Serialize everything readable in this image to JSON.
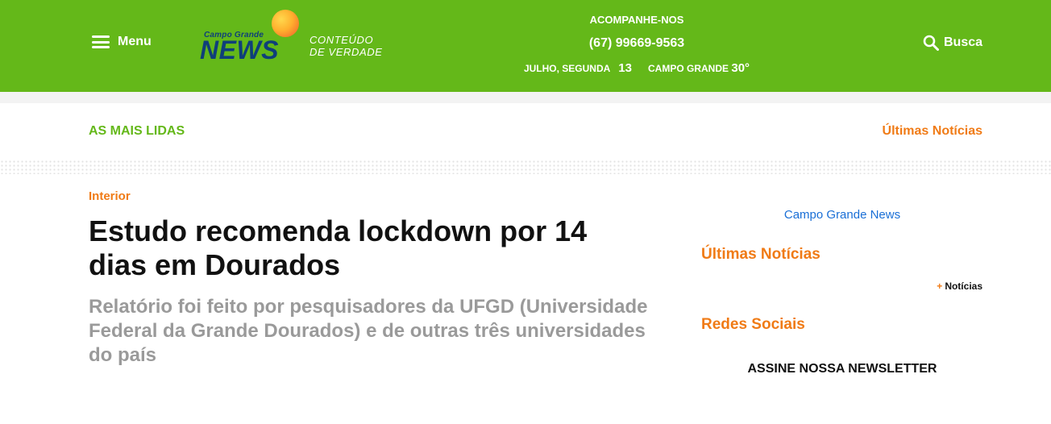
{
  "header": {
    "menu_label": "Menu",
    "logo": {
      "small": "Campo Grande",
      "big": "NEWS"
    },
    "tagline_line1": "CONTEÚDO",
    "tagline_line2": "DE VERDADE",
    "follow_label": "ACOMPANHE-NOS",
    "phone": "(67) 99669-9563",
    "date_label": "JULHO, SEGUNDA",
    "date_day": "13",
    "city": "CAMPO GRANDE",
    "temperature": "30°",
    "search_label": "Busca"
  },
  "subnav": {
    "most_read": "AS MAIS LIDAS",
    "latest": "Últimas Notícias"
  },
  "article": {
    "category": "Interior",
    "headline": "Estudo recomenda lockdown por 14 dias em Dourados",
    "subheadline": "Relatório foi feito por pesquisadores da UFGD (Universidade Federal da Grande Dourados) e de outras três universidades do país"
  },
  "sidebar": {
    "site_link": "Campo Grande News",
    "latest_title": "Últimas Notícias",
    "more_plus": "+",
    "more_label": "Notícias",
    "social_title": "Redes Sociais",
    "newsletter": "ASSINE NOSSA NEWSLETTER"
  },
  "colors": {
    "header_green": "#64b819",
    "accent_orange": "#f07b16",
    "logo_blue": "#0f3f7a",
    "link_blue": "#1a6fd6"
  },
  "icons": [
    "hamburger-icon",
    "search-icon"
  ]
}
